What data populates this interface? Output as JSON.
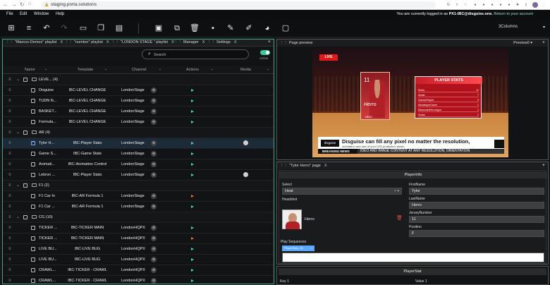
{
  "browser": {
    "url": "staging.porta.solutions"
  },
  "menu": {
    "items": [
      "File",
      "Edit",
      "Window",
      "Help"
    ]
  },
  "login": {
    "prefix": "You are currently logged in as ",
    "user": "PX1-IBC@disguise.one.",
    "link": "Return to your account"
  },
  "layout_select": {
    "value": "3Columns"
  },
  "left_tabs": [
    {
      "label": "\"Marcos-Demos\" playlist"
    },
    {
      "label": "\"number\" playlist"
    },
    {
      "label": "\"LONDON STAGE \" playlist"
    },
    {
      "label": "Manager"
    },
    {
      "label": "Settings"
    }
  ],
  "search": {
    "placeholder": "Search"
  },
  "active_label": "Active",
  "columns": {
    "name": "Name",
    "template": "Template",
    "channel": "Channel",
    "actions": "Actions",
    "media": "Media"
  },
  "rows": [
    {
      "kind": "group",
      "name": "LEVE... (4)",
      "collapsed": false
    },
    {
      "kind": "item",
      "name": "Disguise",
      "template": "IBC-LEVEL CHANGE",
      "channel": "LondonStage",
      "play": "green"
    },
    {
      "kind": "item",
      "name": "TUDN N...",
      "template": "IBC-LEVEL CHANGE",
      "channel": "LondonStage",
      "play": "green"
    },
    {
      "kind": "item",
      "name": "BASKET...",
      "template": "IBC-LEVEL CHANGE",
      "channel": "LondonStage",
      "play": "green"
    },
    {
      "kind": "item",
      "name": "Formula...",
      "template": "IBC-LEVEL CHANGE",
      "channel": "LondonStage",
      "play": "green"
    },
    {
      "kind": "group",
      "name": "AR (4)",
      "collapsed": false
    },
    {
      "kind": "item",
      "name": "Tylor H...",
      "template": "IBC-Player Stats",
      "channel": "LondonStage",
      "play": "green",
      "selected": true,
      "media": true
    },
    {
      "kind": "item",
      "name": "Game S...",
      "template": "IBC-Game Stats",
      "channel": "LondonStage",
      "play": "green"
    },
    {
      "kind": "item",
      "name": "Animati...",
      "template": "IBC-Animation Control",
      "channel": "LondonStage",
      "play": "green"
    },
    {
      "kind": "item",
      "name": "Lebron ...",
      "template": "IBC-Player Stats",
      "channel": "LondonStage",
      "play": "green",
      "media": true
    },
    {
      "kind": "group",
      "name": "F1 (2)",
      "collapsed": false
    },
    {
      "kind": "item",
      "name": "F1 Car In",
      "template": "IBC-AR Formula 1",
      "channel": "LondonStage",
      "play": "red"
    },
    {
      "kind": "item",
      "name": "F1 Car ...",
      "template": "IBC-AR Formula 1",
      "channel": "LondonStage",
      "play": "green"
    },
    {
      "kind": "group",
      "name": "CG (10)",
      "collapsed": false
    },
    {
      "kind": "item",
      "name": "TICKER ...",
      "template": "IBC-TICKER MAIN",
      "channel": "LondonHQPX",
      "play": "green"
    },
    {
      "kind": "item",
      "name": "TICKER ...",
      "template": "IBC-TICKER MAIN",
      "channel": "LondonHQPX",
      "play": "red"
    },
    {
      "kind": "item",
      "name": "LIVE BU...",
      "template": "IBC-LIVE BUG",
      "channel": "LondonHQPX",
      "play": "green"
    },
    {
      "kind": "item",
      "name": "LIVE BU...",
      "template": "IBC-LIVE BUG",
      "channel": "LondonHQPX",
      "play": "green"
    },
    {
      "kind": "item",
      "name": "CRAWL...",
      "template": "IBC-TICKER - CRAWL",
      "channel": "LondonHQPX",
      "play": "green"
    },
    {
      "kind": "item",
      "name": "CRAWL...",
      "template": "IBC-TICKER - CRAWL",
      "channel": "LondonHQPX",
      "play": "green"
    }
  ],
  "preview": {
    "title": "Page preview",
    "zoom": "Preview0",
    "live": "LIVE",
    "stats_title": "PLAYER STATS",
    "stats": [
      {
        "label": "Shots",
        "value": "11"
      },
      {
        "label": "Assist",
        "value": "7"
      },
      {
        "label": "GamesPlayed",
        "value": "3"
      },
      {
        "label": "MinutesperGame",
        "value": "1"
      },
      {
        "label": "ReboundsPerLeague",
        "value": "1"
      },
      {
        "label": "Hooks",
        "value": "1"
      }
    ],
    "player_number": "11",
    "player_signature": "Herro",
    "player_team": "HEAT",
    "ticker_logo": "disguise",
    "ticker_headline": "Disguise can fill any pixel no matter the resolution,",
    "ticker_sub": "orientation and size of your LED production studio.",
    "breaking": "BREAKING NEWS",
    "crawl": "IDEO AND IMAGE CONTENT AT ANY RESOLUTION, ORIENTATION"
  },
  "page": {
    "title": "\"Tylor Herro\" page",
    "section": "PlayerInfo",
    "select_label": "Select",
    "select_value": "Heat",
    "headshot_label": "Headshot",
    "headshot_name": "Herro",
    "first_name_label": "FirstName",
    "first_name": "Tylor",
    "last_name_label": "LastName",
    "last_name": "Herro",
    "jersey_label": "JerseyNumber",
    "jersey": "11",
    "position_label": "Position",
    "position": "F",
    "sequences_label": "Play Sequences",
    "sequence_tag": "PlayerStats_IN",
    "stat_section": "PlayerStat",
    "stat_key": "Key 1",
    "stat_value": "Value 1"
  }
}
